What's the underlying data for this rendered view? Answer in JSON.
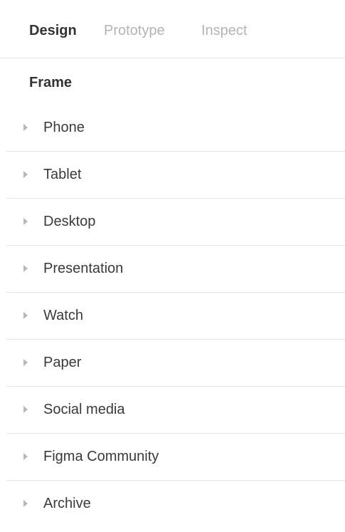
{
  "tabs": {
    "design": "Design",
    "prototype": "Prototype",
    "inspect": "Inspect",
    "active": "Design"
  },
  "section": {
    "title": "Frame"
  },
  "frames": [
    {
      "label": "Phone",
      "icon": "caret-right-icon"
    },
    {
      "label": "Tablet",
      "icon": "caret-right-icon"
    },
    {
      "label": "Desktop",
      "icon": "caret-right-icon"
    },
    {
      "label": "Presentation",
      "icon": "caret-right-icon"
    },
    {
      "label": "Watch",
      "icon": "caret-right-icon"
    },
    {
      "label": "Paper",
      "icon": "caret-right-icon"
    },
    {
      "label": "Social media",
      "icon": "caret-right-icon"
    },
    {
      "label": "Figma Community",
      "icon": "caret-right-icon"
    },
    {
      "label": "Archive",
      "icon": "caret-right-icon"
    }
  ],
  "colors": {
    "active_text": "#333333",
    "inactive_text": "#b3b3b3",
    "divider": "#e6e6e6",
    "caret": "#b8b8b8"
  }
}
